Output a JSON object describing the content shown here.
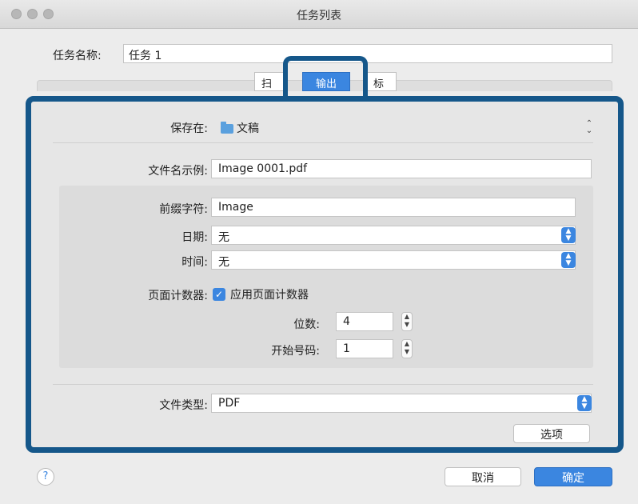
{
  "window": {
    "title": "任务列表"
  },
  "job": {
    "name_label": "任务名称:",
    "name_value": "任务 1"
  },
  "tabs": {
    "scan": "扫",
    "output": "输出",
    "dest": "标"
  },
  "save": {
    "label": "保存在:",
    "value": "文稿"
  },
  "filename": {
    "label": "文件名示例:",
    "value": "Image 0001.pdf"
  },
  "prefix": {
    "label": "前缀字符:",
    "value": "Image"
  },
  "date": {
    "label": "日期:",
    "value": "无"
  },
  "time": {
    "label": "时间:",
    "value": "无"
  },
  "counter": {
    "label": "页面计数器:",
    "checkbox_label": "应用页面计数器",
    "checked": true
  },
  "digits": {
    "label": "位数:",
    "value": "4"
  },
  "start": {
    "label": "开始号码:",
    "value": "1"
  },
  "filetype": {
    "label": "文件类型:",
    "value": "PDF"
  },
  "buttons": {
    "options": "选项",
    "cancel": "取消",
    "ok": "确定",
    "help": "?"
  }
}
